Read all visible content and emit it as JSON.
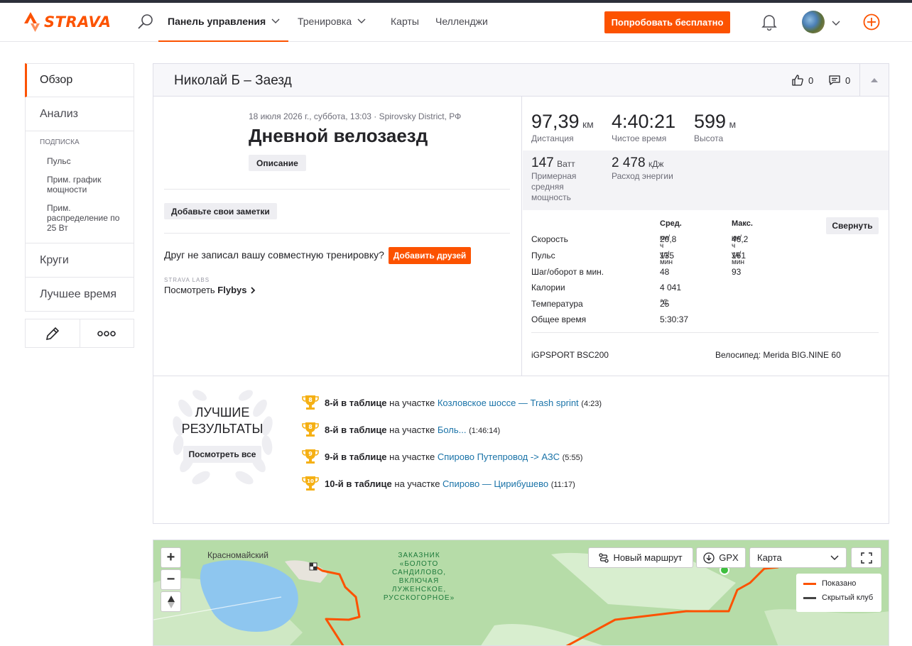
{
  "header": {
    "brand": "STRAVA",
    "nav": [
      {
        "label": "Панель управления",
        "active": true
      },
      {
        "label": "Тренировка",
        "active": false
      },
      {
        "label": "Карты",
        "active": false
      },
      {
        "label": "Челленджи",
        "active": false
      }
    ],
    "trial_button": "Попробовать бесплатно",
    "accent": "#fc5200"
  },
  "sidebar": {
    "overview": "Обзор",
    "analysis": "Анализ",
    "subscription_title": "ПОДПИСКА",
    "subscription_links": [
      "Пульс",
      "Прим. график мощности",
      "Прим. распределение по 25 Вт"
    ],
    "laps": "Круги",
    "best_efforts": "Лучшее время"
  },
  "activity": {
    "header_title": "Николай Б – Заезд",
    "kudos_count": "0",
    "comments_count": "0",
    "meta": "18 июля 2026 г., суббота, 13:03 · Spirovsky District, РФ",
    "name": "Дневной велозаезд",
    "description_button": "Описание",
    "notes_button": "Добавьте свои заметки",
    "friend_question": "Друг не записал вашу совместную тренировку?",
    "add_friends_button": "Добавить друзей",
    "labs_label": "STRAVA LABS",
    "flybys_prefix": "Посмотреть ",
    "flybys_bold": "Flybys"
  },
  "stats": {
    "distance": {
      "value": "97,39",
      "unit": "км",
      "label": "Дистанция"
    },
    "moving_time": {
      "value": "4:40:21",
      "label": "Чистое время"
    },
    "elevation": {
      "value": "599",
      "unit": "м",
      "label": "Высота"
    },
    "power": {
      "value": "147",
      "unit": "Ватт",
      "label": "Примерная средняя мощность"
    },
    "energy": {
      "value": "2 478",
      "unit": "кДж",
      "label": "Расход энергии"
    }
  },
  "details": {
    "avg_header": "Сред.",
    "max_header": "Макс.",
    "collapse_button": "Свернуть",
    "rows": [
      {
        "label": "Скорость",
        "avg": "20,8",
        "avg_unit": "км/ч",
        "max": "46,2",
        "max_unit": "км/ч"
      },
      {
        "label": "Пульс",
        "avg": "135",
        "avg_unit": "уд/мин",
        "max": "161",
        "max_unit": "уд/мин"
      },
      {
        "label": "Шаг/оборот в мин.",
        "avg": "48",
        "avg_unit": "",
        "max": "93",
        "max_unit": ""
      },
      {
        "label": "Калории",
        "avg": "4 041",
        "avg_unit": "",
        "max": "",
        "max_unit": ""
      },
      {
        "label": "Температура",
        "avg": "25",
        "avg_unit": "℃",
        "max": "",
        "max_unit": ""
      },
      {
        "label": "Общее время",
        "avg": "5:30:37",
        "avg_unit": "",
        "max": "",
        "max_unit": ""
      }
    ],
    "device": "iGPSPORT BSC200",
    "bike_label": "Велосипед: ",
    "bike_name": "Merida BIG.NINE 60"
  },
  "achievements": {
    "title_line1": "ЛУЧШИЕ",
    "title_line2": "РЕЗУЛЬТАТЫ",
    "see_all": "Посмотреть все",
    "items": [
      {
        "rank_num": "8",
        "rank": "8-й в таблице",
        "on": " на участке ",
        "segment": "Козловское шоссе — Trash sprint",
        "time": "(4:23)"
      },
      {
        "rank_num": "8",
        "rank": "8-й в таблице",
        "on": " на участке ",
        "segment": "Боль...",
        "time": "(1:46:14)"
      },
      {
        "rank_num": "9",
        "rank": "9-й в таблице",
        "on": " на участке ",
        "segment": "Спирово Путепровод -> АЗС",
        "time": "(5:55)"
      },
      {
        "rank_num": "10",
        "rank": "10-й в таблице",
        "on": " на участке ",
        "segment": "Спирово — Цирибушево",
        "time": "(11:17)"
      }
    ]
  },
  "map": {
    "zoom_in": "+",
    "zoom_out": "−",
    "new_route": "Новый маршрут",
    "gpx": "GPX",
    "layer_select": "Карта",
    "legend_shown": "Показано",
    "legend_hidden": "Скрытый клуб",
    "town_label": "Красномайский",
    "reserve_label": "ЗАКАЗНИК «БОЛОТО САНДИЛОВО, ВКЛЮЧАЯ ЛУЖЕНСКОЕ, РУССКОГОРНОЕ»",
    "route_color": "#fc5200"
  }
}
